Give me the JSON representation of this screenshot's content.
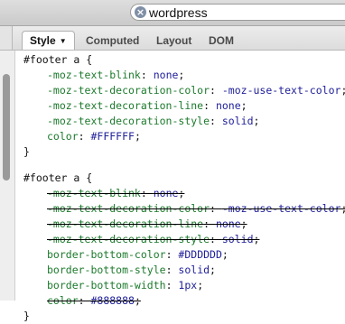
{
  "search": {
    "value": "wordpress",
    "clear_glyph": "×"
  },
  "tabs": [
    {
      "label": "Style",
      "active": true,
      "caret": "▼"
    },
    {
      "label": "Computed",
      "active": false
    },
    {
      "label": "Layout",
      "active": false
    },
    {
      "label": "DOM",
      "active": false
    }
  ],
  "rules": [
    {
      "selector": "#footer a {",
      "close": "}",
      "declarations": [
        {
          "property": "-moz-text-blink",
          "value": "none",
          "overridden": false
        },
        {
          "property": "-moz-text-decoration-color",
          "value": "-moz-use-text-color",
          "overridden": false
        },
        {
          "property": "-moz-text-decoration-line",
          "value": "none",
          "overridden": false
        },
        {
          "property": "-moz-text-decoration-style",
          "value": "solid",
          "overridden": false
        },
        {
          "property": "color",
          "value": "#FFFFFF",
          "overridden": false
        }
      ]
    },
    {
      "selector": "#footer a {",
      "close": "}",
      "declarations": [
        {
          "property": "-moz-text-blink",
          "value": "none",
          "overridden": true
        },
        {
          "property": "-moz-text-decoration-color",
          "value": "-moz-use-text-color",
          "overridden": true
        },
        {
          "property": "-moz-text-decoration-line",
          "value": "none",
          "overridden": true
        },
        {
          "property": "-moz-text-decoration-style",
          "value": "solid",
          "overridden": true
        },
        {
          "property": "border-bottom-color",
          "value": "#DDDDDD",
          "overridden": false
        },
        {
          "property": "border-bottom-style",
          "value": "solid",
          "overridden": false
        },
        {
          "property": "border-bottom-width",
          "value": "1px",
          "overridden": false
        },
        {
          "property": "color",
          "value": "#888888",
          "overridden": true
        }
      ]
    }
  ],
  "colors": {
    "property": "#1c7a2c",
    "value": "#20209a"
  }
}
